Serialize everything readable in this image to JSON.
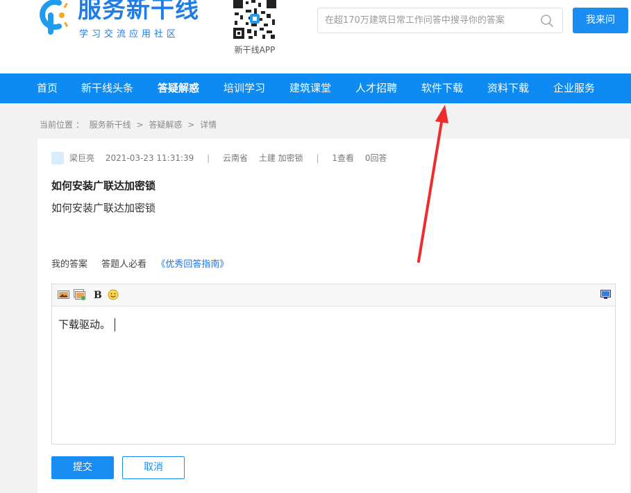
{
  "header": {
    "logo_title": "服务新干线",
    "logo_subtitle": "学习交流应用社区",
    "qr_label": "新干线APP",
    "search_placeholder": "在超170万建筑日常工作问答中搜寻你的答案",
    "ask_button": "我来问"
  },
  "nav": {
    "items": [
      {
        "label": "首页"
      },
      {
        "label": "新干线头条"
      },
      {
        "label": "答疑解惑",
        "active": true
      },
      {
        "label": "培训学习"
      },
      {
        "label": "建筑课堂"
      },
      {
        "label": "人才招聘"
      },
      {
        "label": "软件下载"
      },
      {
        "label": "资料下载"
      },
      {
        "label": "企业服务"
      }
    ]
  },
  "breadcrumb": {
    "prefix": "当前位置 ：",
    "items": [
      "服务新干线",
      "答疑解惑",
      "详情"
    ],
    "separator": ">"
  },
  "question": {
    "author": "梁巨亮",
    "datetime": "2021-03-23 11:31:39",
    "region": "云南省",
    "tags": "土建 加密锁",
    "views": "1查看",
    "answers": "0回答",
    "title": "如何安装广联达加密锁",
    "body": "如何安装广联达加密锁"
  },
  "answer_section": {
    "my_answer": "我的答案",
    "must_read": "答题人必看",
    "guide_link": "《优秀回答指南》"
  },
  "editor": {
    "content": "下载驱动。",
    "toolbar_icons": [
      "image-icon",
      "gallery-icon",
      "bold-icon",
      "emoji-icon",
      "preview-icon"
    ],
    "bold_label": "B"
  },
  "actions": {
    "submit": "提交",
    "cancel": "取消"
  },
  "colors": {
    "brand_blue": "#0d8bf2",
    "annotation_red": "#f02b2b"
  }
}
